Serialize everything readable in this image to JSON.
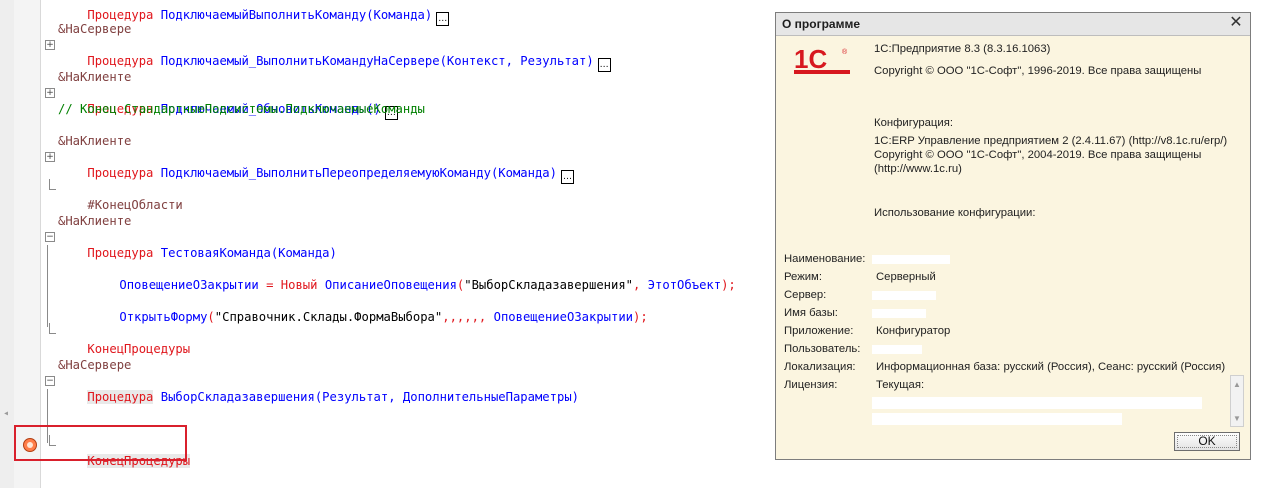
{
  "code": {
    "l0": {
      "kw": "Процедура",
      "name": "ПодключаемыйВыполнитьКоманду(Команда)"
    },
    "l1": {
      "ann": "&НаСервере"
    },
    "l2": {
      "kw": "Процедура",
      "name": "Подключаемый_ВыполнитьКомандуНаСервере",
      "params": "(Контекст, Результат)"
    },
    "l4": {
      "ann": "&НаКлиенте"
    },
    "l5": {
      "kw": "Процедура",
      "name": "Подключаемый_ОбновитьКоманды",
      "params": "()"
    },
    "l6": {
      "comment": "// Конец СтандартныеПодсистемы.ПодключаемыеКоманды"
    },
    "l8": {
      "ann": "&НаКлиенте"
    },
    "l9": {
      "kw": "Процедура",
      "name": "Подключаемый_ВыполнитьПереопределяемуюКоманду",
      "params": "(Команда)"
    },
    "l11": {
      "text": "#КонецОбласти"
    },
    "l13": {
      "ann": "&НаКлиенте"
    },
    "l14": {
      "kw": "Процедура",
      "name": "ТестоваяКоманда",
      "params": "(Команда)"
    },
    "l16": {
      "a": "ОповещениеОЗакрытии",
      "b": " = ",
      "c": "Новый",
      "d": " ",
      "e": "ОписаниеОповещения",
      "f": "(",
      "g": "\"ВыборСкладазавершения\"",
      "h": ", ",
      "i": "ЭтотОбъект",
      "j": ");"
    },
    "l18": {
      "a": "ОткрытьФорму",
      "b": "(",
      "c": "\"Справочник.Склады.ФормаВыбора\"",
      "d": ",,,,,,",
      "e": " ОповещениеОЗакрытии",
      "f": ");"
    },
    "l20": {
      "kw": "КонецПроцедуры"
    },
    "l22": {
      "ann": "&НаСервере"
    },
    "l23": {
      "kw": "Процедура",
      "name": "ВыборСкладазавершения",
      "params": "(Результат, ДополнительныеПараметры)"
    },
    "l26": {
      "kw": "КонецПроцедуры"
    }
  },
  "dialog": {
    "title": "О программе",
    "logo_text": "1С",
    "platform": "1С:Предприятие 8.3 (8.3.16.1063)",
    "platform_copyright": "Copyright © ООО \"1С-Софт\", 1996-2019. Все права защищены",
    "config_heading": "Конфигурация:",
    "config_name": "1С:ERP Управление предприятием 2 (2.4.11.67) (http://v8.1c.ru/erp/)",
    "config_copyright": "Copyright © ООО \"1С-Софт\", 2004-2019. Все права защищены",
    "config_url": "(http://www.1c.ru)",
    "usage_heading": "Использование конфигурации:",
    "fields": [
      {
        "label": "Наименование:",
        "value": ""
      },
      {
        "label": "Режим:",
        "value": "Серверный"
      },
      {
        "label": "Сервер:",
        "value": ""
      },
      {
        "label": "Имя базы:",
        "value": ""
      },
      {
        "label": "Приложение:",
        "value": "Конфигуратор"
      },
      {
        "label": "Пользователь:",
        "value": ""
      },
      {
        "label": "Локализация:",
        "value": "Информационная база: русский (Россия), Сеанс: русский (Россия)"
      },
      {
        "label": "Лицензия:",
        "value": "Текущая:"
      }
    ],
    "ok_label": "OK",
    "close_glyph": "✕",
    "scroll_up": "▲",
    "scroll_down": "▼"
  },
  "colors": {
    "keyword": "#e0161c",
    "identifier": "#0000ff",
    "annotation": "#804040",
    "comment": "#008000",
    "highlight_frame": "#d9202c",
    "dialog_bg": "#fbf5e0"
  }
}
